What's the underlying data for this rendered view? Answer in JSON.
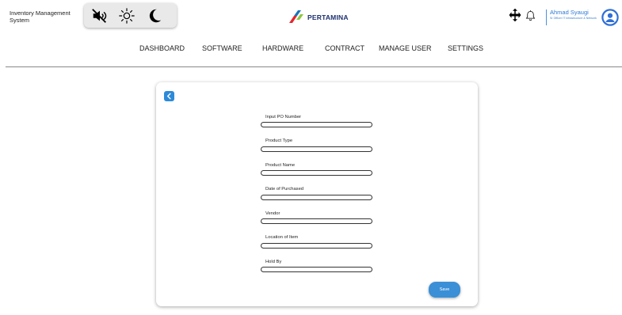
{
  "header": {
    "app_title": "Inventory Management System",
    "logo_text": "PERTAMINA",
    "user_name": "Ahmad Syaugi",
    "user_role": "Sr Officer IT Infrastructure & Network"
  },
  "toggles": {
    "icons": [
      "mute-icon",
      "sun-icon",
      "moon-icon"
    ]
  },
  "nav": {
    "items": [
      {
        "label": "DASHBOARD"
      },
      {
        "label": "SOFTWARE"
      },
      {
        "label": "HARDWARE"
      },
      {
        "label": "CONTRACT"
      },
      {
        "label": "MANAGE USER"
      },
      {
        "label": "SETTINGS"
      }
    ]
  },
  "form": {
    "fields": [
      {
        "label": "Input PO Number",
        "value": ""
      },
      {
        "label": "Product Type",
        "value": ""
      },
      {
        "label": "Product Name",
        "value": ""
      },
      {
        "label": "Date of Purchased",
        "value": ""
      },
      {
        "label": "Vendor",
        "value": ""
      },
      {
        "label": "Location of Item",
        "value": ""
      },
      {
        "label": "Hold By",
        "value": ""
      }
    ],
    "save_label": "Save"
  },
  "colors": {
    "accent": "#3a8fd6",
    "back_button": "#2d8ad9",
    "brand_navy": "#1b2f6e",
    "brand_red": "#e5262c",
    "brand_green": "#8dc63f",
    "brand_blue": "#1a75bb"
  }
}
